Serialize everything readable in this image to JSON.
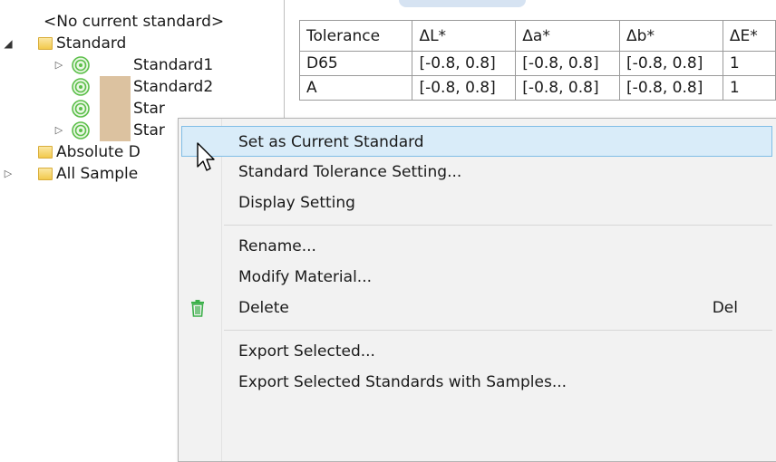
{
  "tree": {
    "no_current": "<No current standard>",
    "standard_folder": "Standard",
    "items": [
      "Standard1",
      "Standard2",
      "Star",
      "Star"
    ],
    "absolute": "Absolute D",
    "all_samples": "All Sample"
  },
  "table": {
    "headers": [
      "Tolerance",
      "ΔL*",
      "Δa*",
      "Δb*",
      "ΔE*"
    ],
    "rows": [
      [
        "D65",
        "[-0.8, 0.8]",
        "[-0.8, 0.8]",
        "[-0.8, 0.8]",
        "1"
      ],
      [
        "A",
        "[-0.8, 0.8]",
        "[-0.8, 0.8]",
        "[-0.8, 0.8]",
        "1"
      ]
    ]
  },
  "menu": {
    "items": [
      "Set as Current Standard",
      "Standard Tolerance Setting...",
      "Display Setting",
      "Rename...",
      "Modify Material...",
      "Delete",
      "Export Selected...",
      "Export Selected Standards with Samples..."
    ],
    "delete_shortcut": "Del",
    "delete_icon": "trash-icon",
    "highlight_color": "#d9ecf9",
    "accent_color": "#80bde6"
  }
}
